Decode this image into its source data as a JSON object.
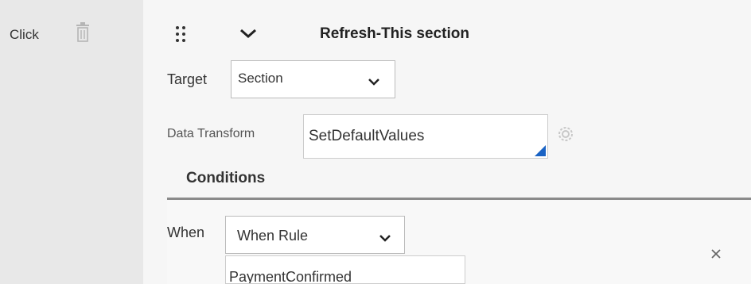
{
  "action": {
    "label": "Click",
    "trash_icon": "trash-icon"
  },
  "section": {
    "title": "Refresh-This section",
    "drag_icon": "drag-handle-icon",
    "collapse_icon": "chevron-down-icon"
  },
  "target": {
    "label": "Target",
    "value": "Section"
  },
  "data_transform": {
    "label": "Data Transform",
    "value": "SetDefaultValues",
    "gear_icon": "gear-icon"
  },
  "conditions": {
    "heading": "Conditions",
    "when_label": "When",
    "when_select_value": "When Rule",
    "rule_value": "PaymentConfirmed",
    "close_icon": "close-icon"
  },
  "colors": {
    "accent": "#1a63c4",
    "divider": "#8a8a8a"
  }
}
